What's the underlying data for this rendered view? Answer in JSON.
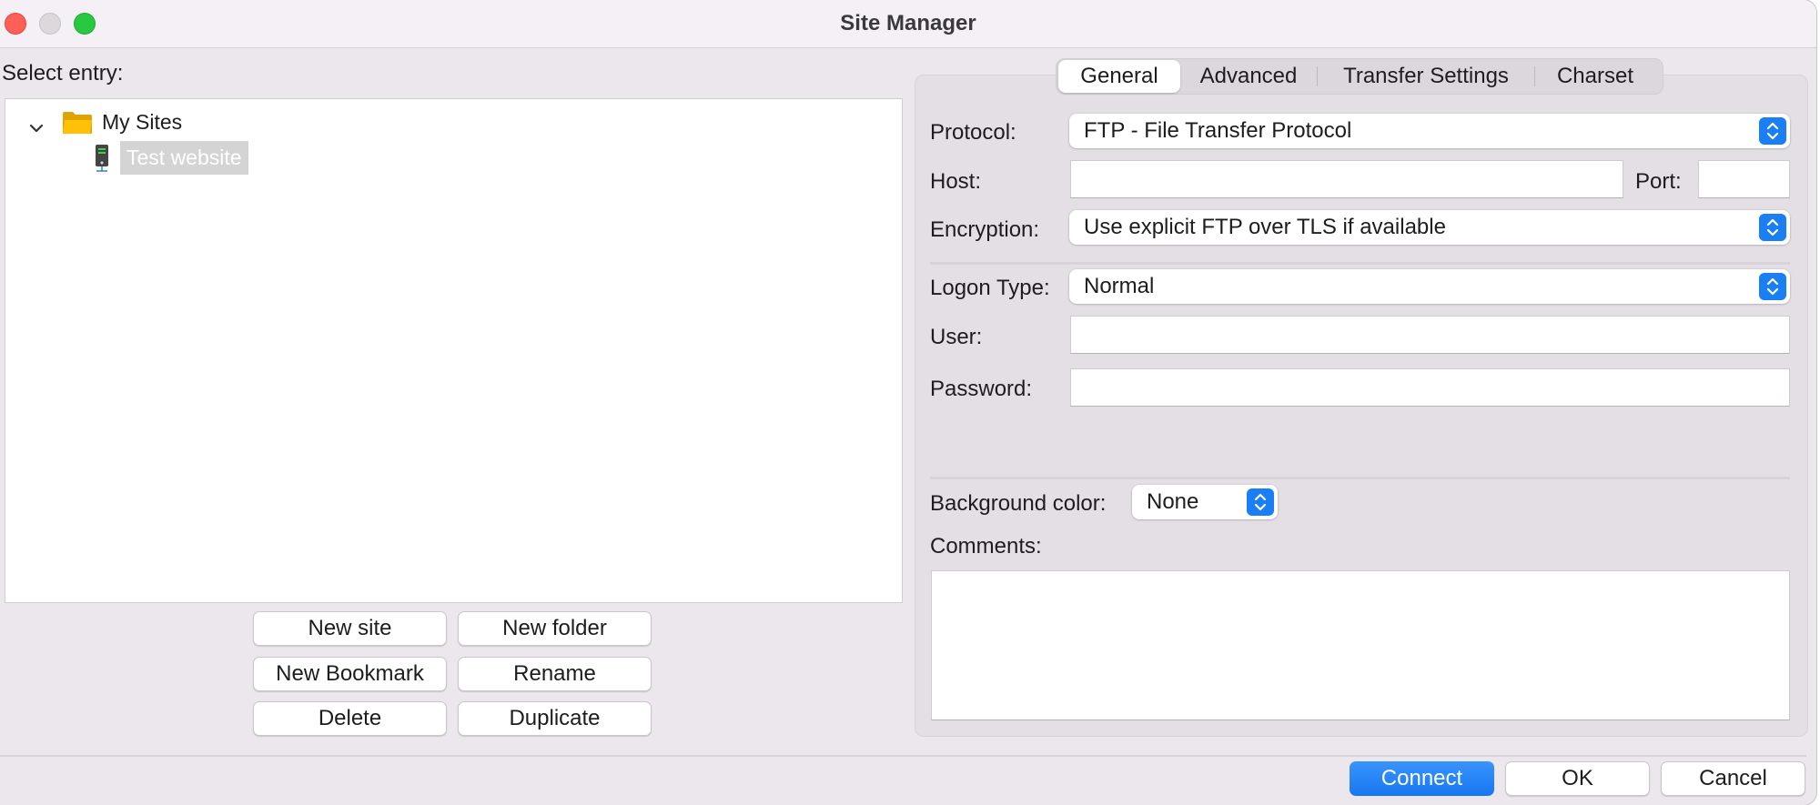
{
  "window": {
    "title": "Site Manager",
    "traffic_lights": [
      "close",
      "minimize",
      "maximize"
    ]
  },
  "left": {
    "select_entry_label": "Select entry:",
    "tree": {
      "folder": {
        "label": "My Sites",
        "icon": "folder-icon",
        "expanded": true
      },
      "sites": [
        {
          "label": "Test website",
          "icon": "server-icon",
          "selected": true
        }
      ]
    },
    "buttons": {
      "new_site": "New site",
      "new_folder": "New folder",
      "new_bookmark": "New Bookmark",
      "rename": "Rename",
      "delete": "Delete",
      "duplicate": "Duplicate"
    }
  },
  "right": {
    "tabs": [
      {
        "label": "General",
        "active": true
      },
      {
        "label": "Advanced",
        "active": false
      },
      {
        "label": "Transfer Settings",
        "active": false
      },
      {
        "label": "Charset",
        "active": false
      }
    ],
    "protocol": {
      "label": "Protocol:",
      "value": "FTP - File Transfer Protocol"
    },
    "host": {
      "label": "Host:",
      "value": ""
    },
    "port": {
      "label": "Port:",
      "value": ""
    },
    "encryption": {
      "label": "Encryption:",
      "value": "Use explicit FTP over TLS if available"
    },
    "logon_type": {
      "label": "Logon Type:",
      "value": "Normal"
    },
    "user": {
      "label": "User:",
      "value": ""
    },
    "password": {
      "label": "Password:",
      "value": ""
    },
    "background_color": {
      "label": "Background color:",
      "value": "None"
    },
    "comments": {
      "label": "Comments:",
      "value": ""
    }
  },
  "footer": {
    "connect": "Connect",
    "ok": "OK",
    "cancel": "Cancel"
  },
  "colors": {
    "accent": "#1a7ef5",
    "selection": "#d4d4d4",
    "folder": "#f5b400"
  }
}
